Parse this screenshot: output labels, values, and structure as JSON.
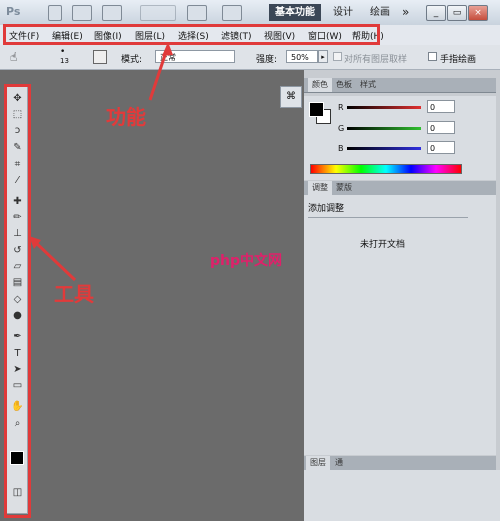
{
  "app": {
    "logo": "Ps"
  },
  "workspace": {
    "tabs": [
      "基本功能",
      "设计",
      "绘画"
    ],
    "more": "»"
  },
  "window_controls": {
    "minimize": "_",
    "maximize": "▭",
    "close": "×"
  },
  "menubar": [
    "文件(F)",
    "编辑(E)",
    "图像(I)",
    "图层(L)",
    "选择(S)",
    "滤镜(T)",
    "视图(V)",
    "窗口(W)",
    "帮助(H)"
  ],
  "options_bar": {
    "brush_size": "13",
    "mode_label": "模式:",
    "mode_value": "正常",
    "strength_label": "强度:",
    "strength_value": "50%",
    "sample_all_layers": "对所有图层取样",
    "finger_paint": "手指绘画"
  },
  "panels": {
    "color_tabs": [
      "颜色",
      "色板",
      "样式"
    ],
    "color": {
      "channels": [
        {
          "label": "R",
          "value": "0",
          "color": "#e03030"
        },
        {
          "label": "G",
          "value": "0",
          "color": "#30c030"
        },
        {
          "label": "B",
          "value": "0",
          "color": "#3030e0"
        }
      ]
    },
    "adjust_tabs": [
      "调整",
      "蒙版"
    ],
    "adjust_title": "添加调整",
    "no_document": "未打开文档",
    "bottom_tabs": [
      "图层",
      "通"
    ]
  },
  "annotations": {
    "function_label": "功能",
    "tools_label": "工具"
  },
  "watermark": {
    "text": "php中文网"
  },
  "colors": {
    "highlight": "#e03a3a",
    "accent": "#3b4756"
  }
}
